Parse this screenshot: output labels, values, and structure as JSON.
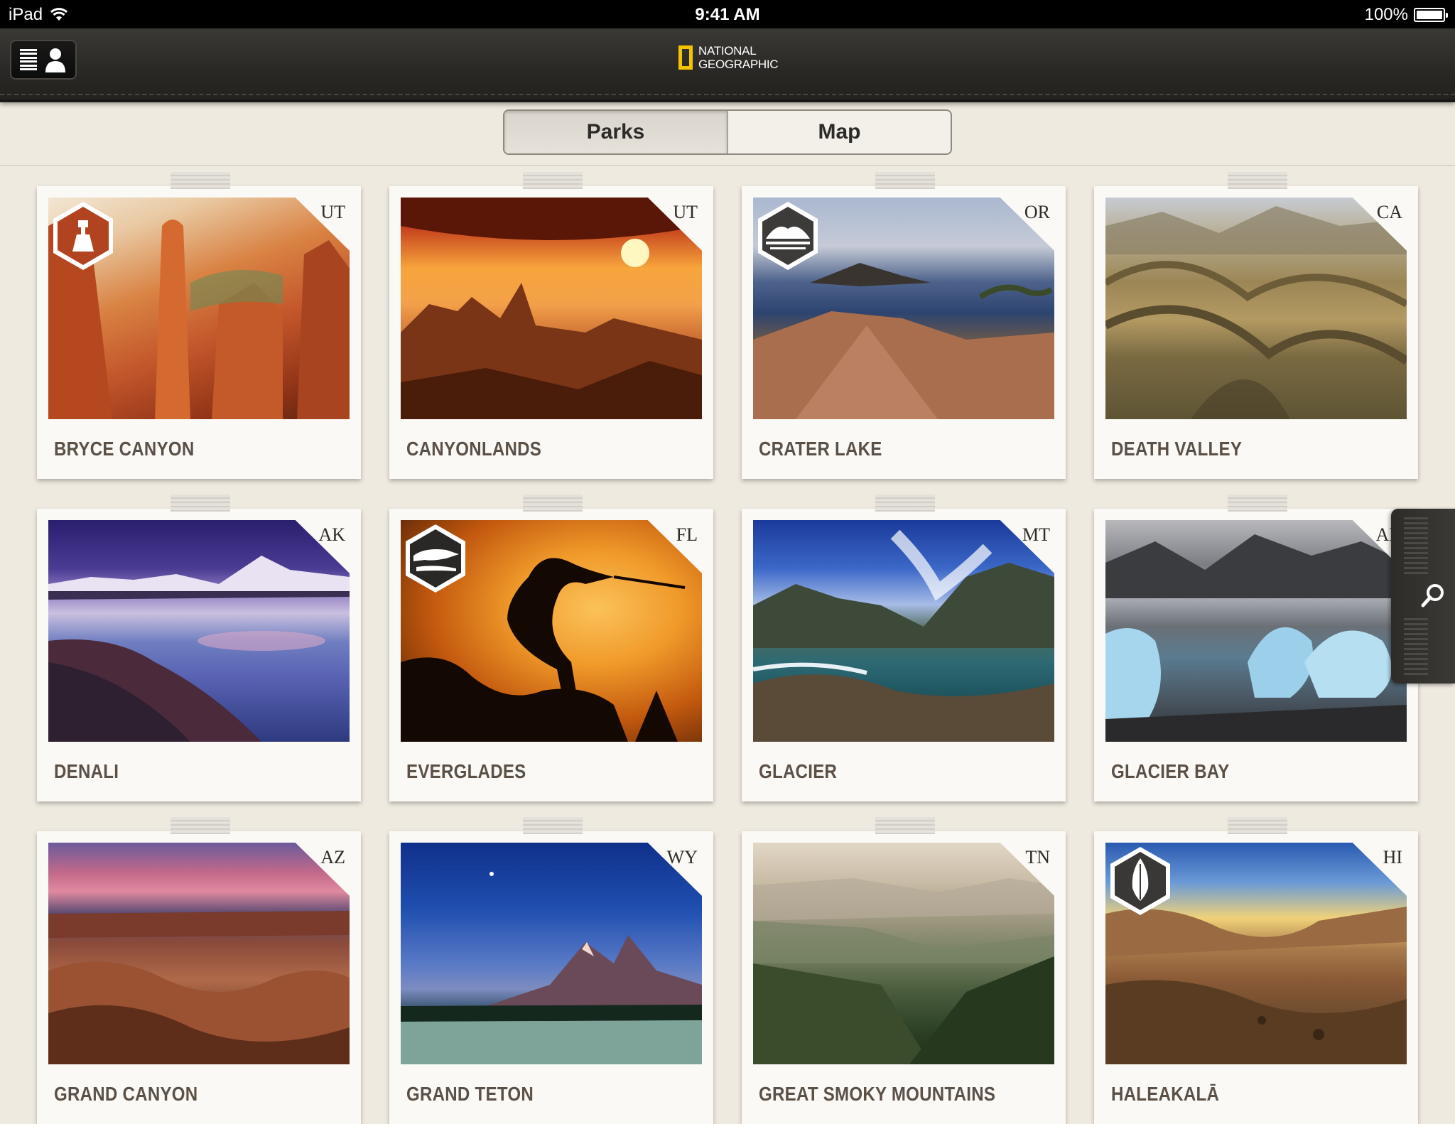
{
  "status_bar": {
    "device": "iPad",
    "time": "9:41 AM",
    "battery": "100%"
  },
  "header": {
    "logo_line1": "NATIONAL",
    "logo_line2": "GEOGRAPHIC"
  },
  "tabs": [
    {
      "label": "Parks",
      "active": true
    },
    {
      "label": "Map",
      "active": false
    }
  ],
  "parks": [
    {
      "name": "BRYCE CANYON",
      "state": "UT",
      "badge": "hoodoo-badge-icon"
    },
    {
      "name": "CANYONLANDS",
      "state": "UT",
      "badge": ""
    },
    {
      "name": "CRATER LAKE",
      "state": "OR",
      "badge": "lake-badge-icon"
    },
    {
      "name": "DEATH VALLEY",
      "state": "CA",
      "badge": ""
    },
    {
      "name": "DENALI",
      "state": "AK",
      "badge": ""
    },
    {
      "name": "EVERGLADES",
      "state": "FL",
      "badge": "alligator-badge-icon"
    },
    {
      "name": "GLACIER",
      "state": "MT",
      "badge": ""
    },
    {
      "name": "GLACIER BAY",
      "state": "AK",
      "badge": ""
    },
    {
      "name": "GRAND CANYON",
      "state": "AZ",
      "badge": ""
    },
    {
      "name": "GRAND TETON",
      "state": "WY",
      "badge": ""
    },
    {
      "name": "GREAT SMOKY MOUNTAINS",
      "state": "TN",
      "badge": ""
    },
    {
      "name": "HALEAKALĀ",
      "state": "HI",
      "badge": "silversword-badge-icon"
    }
  ],
  "icons": {
    "menu": "list-icon",
    "profile": "person-icon",
    "search": "search-icon"
  },
  "colors": {
    "accent_yellow": "#f4c400",
    "header_dark": "#2a2825",
    "paper": "#efeae0"
  }
}
